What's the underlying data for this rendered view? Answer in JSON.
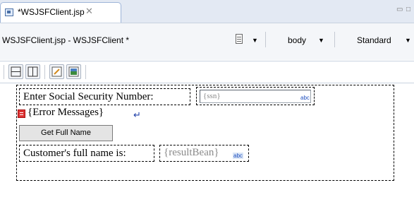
{
  "tab": {
    "title": "*WSJSFClient.jsp",
    "close": "✕"
  },
  "window_controls": {
    "minimize": "▭",
    "maximize": "□"
  },
  "editor_header": {
    "page_title": "WSJSFClient.jsp - WSJSFClient *",
    "page_icon": "page-properties-icon",
    "tag_combo": "body",
    "style_combo": "Standard"
  },
  "toolbar": {
    "buttons": [
      "split-horizontal-icon",
      "split-vertical-icon",
      "edit-icon",
      "image-icon"
    ]
  },
  "design": {
    "ssn_label": "Enter Social Security Number:",
    "ssn_value": "{ssn}",
    "input_badge": "abc",
    "error_text": "{Error Messages}",
    "error_icon": "error-messages-icon",
    "return_glyph": "↵",
    "button_label": "Get Full Name",
    "full_name_label": "Customer's full name is:",
    "result_value": "{resultBean}",
    "output_badge": "abc"
  }
}
